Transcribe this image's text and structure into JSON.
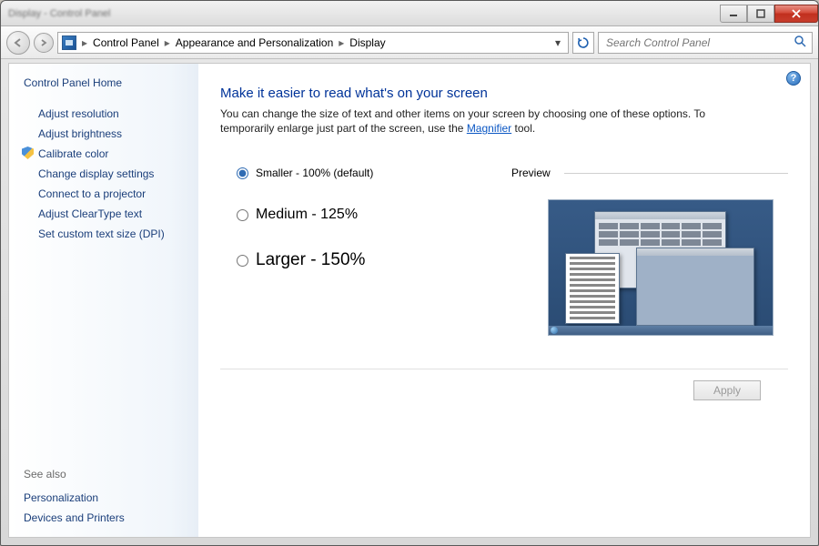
{
  "titlebar_blur": "Display - Control Panel",
  "breadcrumb": {
    "root": "Control Panel",
    "mid": "Appearance and Personalization",
    "leaf": "Display"
  },
  "search": {
    "placeholder": "Search Control Panel"
  },
  "sidebar": {
    "home": "Control Panel Home",
    "links": {
      "l0": "Adjust resolution",
      "l1": "Adjust brightness",
      "l2": "Calibrate color",
      "l3": "Change display settings",
      "l4": "Connect to a projector",
      "l5": "Adjust ClearType text",
      "l6": "Set custom text size (DPI)"
    },
    "see_also": "See also",
    "see_links": {
      "s0": "Personalization",
      "s1": "Devices and Printers"
    }
  },
  "content": {
    "title": "Make it easier to read what's on your screen",
    "desc_pre": "You can change the size of text and other items on your screen by choosing one of these options. To temporarily enlarge just part of the screen, use the ",
    "desc_link": "Magnifier",
    "desc_post": " tool.",
    "radios": {
      "r0": "Smaller - 100% (default)",
      "r1": "Medium - 125%",
      "r2": "Larger - 150%"
    },
    "selected": "r0",
    "preview_label": "Preview",
    "apply": "Apply"
  }
}
